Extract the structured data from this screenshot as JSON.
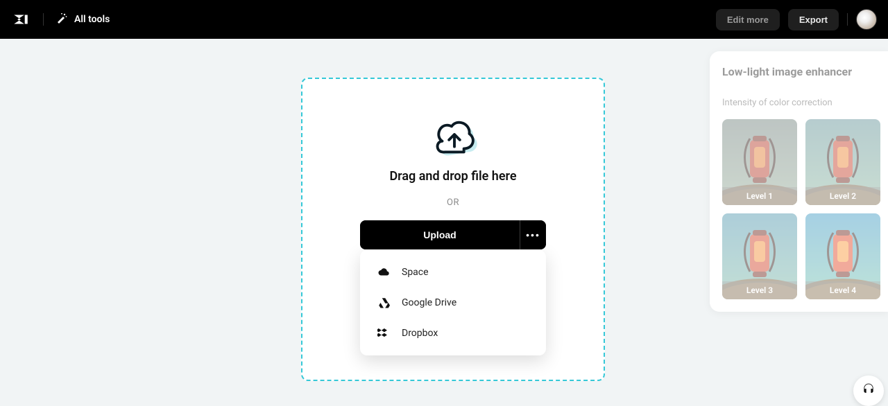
{
  "header": {
    "all_tools_label": "All tools",
    "edit_more_label": "Edit more",
    "export_label": "Export"
  },
  "upload": {
    "drag_text": "Drag and drop file here",
    "or_text": "OR",
    "upload_label": "Upload",
    "menu": [
      {
        "label": "Space",
        "icon": "cloud"
      },
      {
        "label": "Google Drive",
        "icon": "gdrive"
      },
      {
        "label": "Dropbox",
        "icon": "dropbox"
      }
    ]
  },
  "right_panel": {
    "title": "Low-light image enhancer",
    "subtitle": "Intensity of color correction",
    "levels": [
      "Level 1",
      "Level 2",
      "Level 3",
      "Level 4"
    ]
  }
}
